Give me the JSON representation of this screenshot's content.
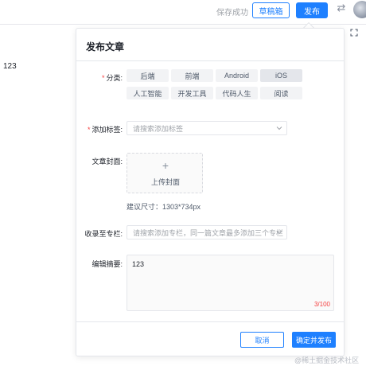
{
  "header": {
    "save_status": "保存成功",
    "draft_label": "草稿箱",
    "publish_label": "发布",
    "swap_icon": "swap-icon",
    "fullscreen_icon": "fullscreen-icon"
  },
  "editor": {
    "content": "123"
  },
  "panel": {
    "title": "发布文章",
    "category": {
      "label": "分类:",
      "required_mark": "*",
      "options": [
        "后端",
        "前端",
        "Android",
        "iOS",
        "人工智能",
        "开发工具",
        "代码人生",
        "阅读"
      ],
      "selected": "iOS"
    },
    "tags": {
      "label": "添加标签:",
      "required_mark": "*",
      "placeholder": "请搜索添加标签"
    },
    "cover": {
      "label": "文章封面:",
      "plus": "+",
      "upload_label": "上传封面",
      "size_hint": "建议尺寸：1303*734px"
    },
    "column": {
      "label": "收录至专栏:",
      "placeholder": "请搜索添加专栏，同一篇文章最多添加三个专栏"
    },
    "summary": {
      "label": "编辑摘要:",
      "value": "123",
      "counter": "3/100"
    },
    "cancel_label": "取消",
    "confirm_label": "确定并发布"
  },
  "watermark": "@稀土掘金技术社区",
  "colors": {
    "accent": "#1e80ff",
    "required": "#f53f3f"
  }
}
